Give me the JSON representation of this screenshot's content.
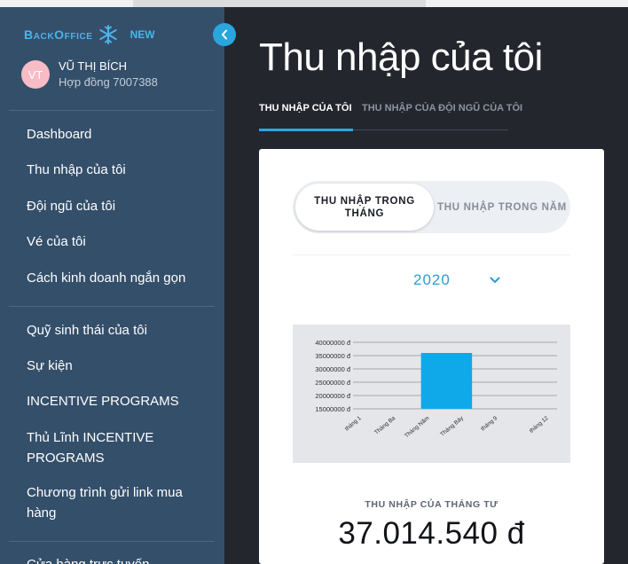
{
  "brand": {
    "name": "BackOffice",
    "badge": "NEW",
    "accent": "#4cb3ea"
  },
  "user": {
    "initials": "VT",
    "name": "VŨ THỊ BÍCH",
    "contract": "Hợp đồng 7007388"
  },
  "nav": {
    "group1": [
      "Dashboard",
      "Thu nhập của tôi",
      "Đội ngũ của tôi",
      "Vé của tôi",
      "Cách kinh doanh ngắn gọn"
    ],
    "group2": [
      "Quỹ sinh thái của tôi",
      "Sự kiện",
      "INCENTIVE PROGRAMS",
      "Thủ Lĩnh INCENTIVE PROGRAMS",
      "Chương trình gửi link mua hàng"
    ],
    "group3": [
      "Cửa hàng trực tuyến"
    ]
  },
  "collapse_icon": "chevron-left-icon",
  "page": {
    "title": "Thu nhập của tôi",
    "tabs": [
      {
        "label": "THU NHẬP CỦA TÔI",
        "active": true
      },
      {
        "label": "THU NHẬP CỦA ĐỘI NGŨ CỦA TÔI",
        "active": false
      }
    ]
  },
  "card": {
    "toggle": [
      "THU NHẬP TRONG THÁNG",
      "THU NHẬP TRONG NĂM"
    ],
    "toggle_selected": "THU NHẬP TRONG THÁNG",
    "year": "2020",
    "selected_month_label": "THU NHẬP CỦA THÁNG TƯ",
    "selected_month_value": "37.014.540 đ"
  },
  "chart_data": {
    "type": "bar",
    "categories": [
      "tháng 1",
      "Tháng Ba",
      "Tháng Năm",
      "Tháng Bảy",
      "tháng 9",
      "tháng 12"
    ],
    "values": [
      12500000,
      13000000,
      36000000,
      0,
      0,
      0
    ],
    "ytick_labels": [
      "40000000 đ",
      "35000000 đ",
      "30000000 đ",
      "25000000 đ",
      "20000000 đ",
      "15000000 đ"
    ],
    "ylim": [
      15000000,
      40000000
    ],
    "bar_color": "#0fa8e8",
    "grid": true
  },
  "colors": {
    "sidebar": "#344f6a",
    "accent": "#2aa6df",
    "background": "#24262e"
  }
}
